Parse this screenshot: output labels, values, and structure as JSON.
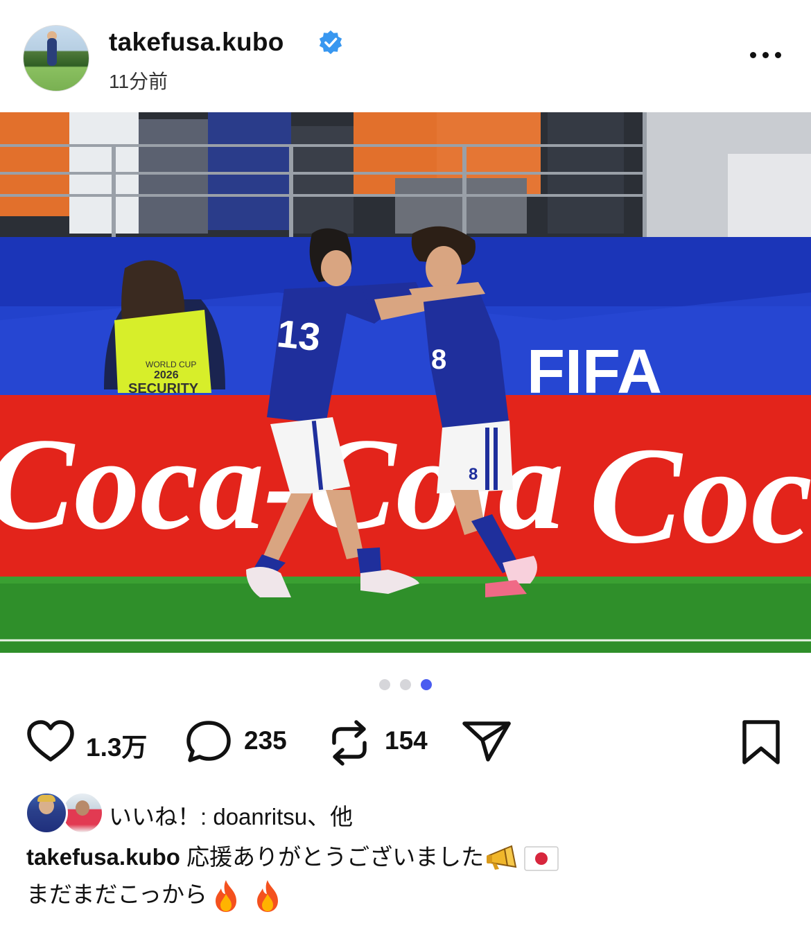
{
  "post": {
    "username": "takefusa.kubo",
    "time_ago": "11分前",
    "carousel": {
      "count": 3,
      "active_index": 2
    },
    "photo_text": {
      "ad_left": "Coca-Cola",
      "ad_right": "Coca",
      "fifa": "FIFA",
      "security_line1": "WORLD CUP",
      "security_year": "2026",
      "security_label": "SECURITY",
      "player_left_number": "13",
      "player_right_number": "8"
    },
    "actions": {
      "likes": "1.3万",
      "comments": "235",
      "reposts": "154"
    },
    "liked_by": "いいね！: doanritsu、他",
    "caption": {
      "author": "takefusa.kubo",
      "line1": "応援ありがとうございました",
      "line2": "まだまだこっから"
    }
  },
  "colors": {
    "verified_blue": "#3897f0",
    "carousel_active": "#4a5cf0",
    "coca_red": "#e3241b",
    "japan_blue": "#1f2f9c",
    "pitch_green": "#2f8f2a"
  }
}
